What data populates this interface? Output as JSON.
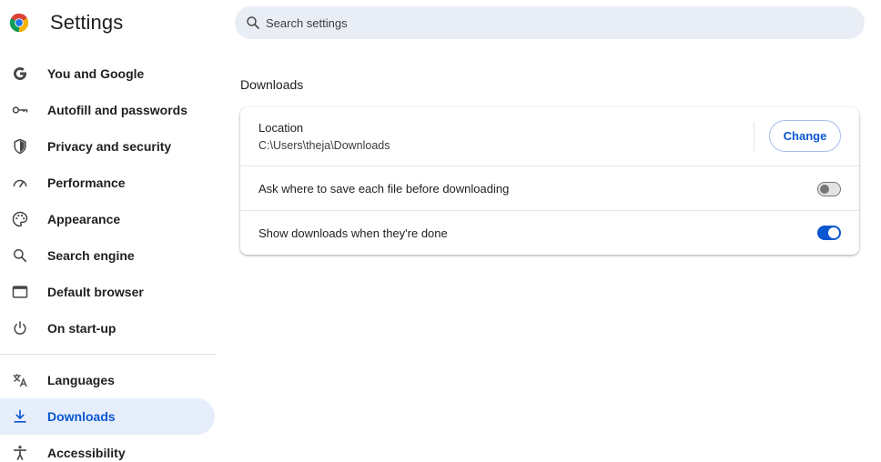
{
  "header": {
    "title": "Settings",
    "logo_icon": "chrome-logo-icon"
  },
  "search": {
    "placeholder": "Search settings",
    "icon": "search-icon"
  },
  "sidebar": {
    "items": [
      {
        "label": "You and Google",
        "icon": "google-g-icon"
      },
      {
        "label": "Autofill and passwords",
        "icon": "key-icon"
      },
      {
        "label": "Privacy and security",
        "icon": "shield-icon"
      },
      {
        "label": "Performance",
        "icon": "speedometer-icon"
      },
      {
        "label": "Appearance",
        "icon": "palette-icon"
      },
      {
        "label": "Search engine",
        "icon": "search-icon"
      },
      {
        "label": "Default browser",
        "icon": "browser-window-icon"
      },
      {
        "label": "On start-up",
        "icon": "power-icon"
      },
      {
        "label": "Languages",
        "icon": "translate-icon"
      },
      {
        "label": "Downloads",
        "icon": "download-icon",
        "active": true
      },
      {
        "label": "Accessibility",
        "icon": "accessibility-icon"
      }
    ]
  },
  "main": {
    "section_title": "Downloads",
    "location": {
      "label": "Location",
      "path": "C:\\Users\\theja\\Downloads",
      "button_label": "Change"
    },
    "ask_where": {
      "label": "Ask where to save each file before downloading",
      "enabled": false
    },
    "show_downloads": {
      "label": "Show downloads when they're done",
      "enabled": true
    }
  },
  "colors": {
    "accent": "#0b57d0",
    "active_nav_bg": "#e6eefb",
    "search_bg": "#e9eef6"
  }
}
